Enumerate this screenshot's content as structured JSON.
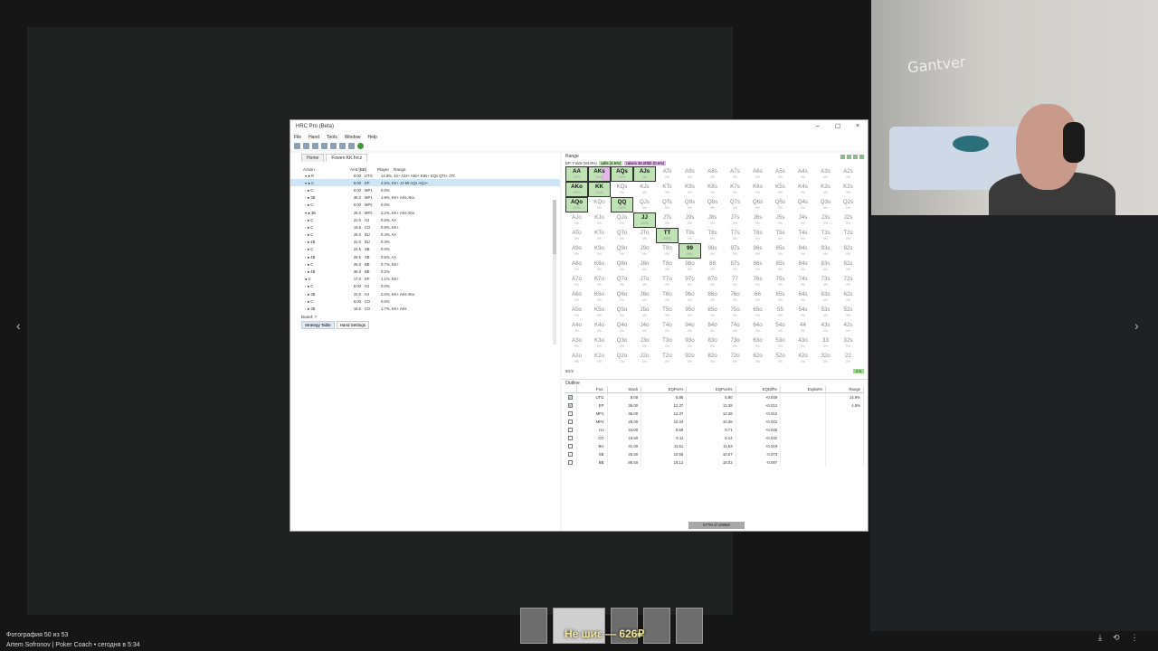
{
  "app": {
    "title": "HRC Pro (Beta)",
    "window_controls": [
      "–",
      "☐",
      "×"
    ],
    "menu": [
      "File",
      "Hand",
      "Tools",
      "Window",
      "Help"
    ],
    "tabs": [
      "Home",
      "Fowen KK.hrcz"
    ],
    "tree_headers": [
      "Action",
      "Amt [BB]",
      "Player",
      "Range"
    ],
    "tree_rows": [
      {
        "action": "▾ ● R",
        "amt": "8.00",
        "player": "UTG",
        "range": "14.9%, 44+ A2s+ A9o+ K9s+ KQo QTs+ JTs",
        "sel": false
      },
      {
        "action": "▾ ● C",
        "amt": "8.00",
        "player": "EP",
        "range": "4.5%, KK+ JJ-99 AQs AQo+",
        "sel": true
      },
      {
        "action": "› ● C",
        "amt": "8.00",
        "player": "MP1",
        "range": "0.0%",
        "sel": false
      },
      {
        "action": "› ● 3B",
        "amt": "36.0",
        "player": "MP1",
        "range": "1.9%, KK+ AKs AKo",
        "sel": false
      },
      {
        "action": "› ● C",
        "amt": "8.00",
        "player": "MP2",
        "range": "0.0%",
        "sel": false
      },
      {
        "action": "▾ ● 3B",
        "amt": "25.0",
        "player": "MP2",
        "range": "2.2%, KK+ AKs AKo",
        "sel": false
      },
      {
        "action": "› ● C",
        "amt": "22.0",
        "player": "HJ",
        "range": "0.6%, AA",
        "sel": false
      },
      {
        "action": "› ● C",
        "amt": "19.5",
        "player": "CO",
        "range": "0.9%, KK+",
        "sel": false
      },
      {
        "action": "› ● C",
        "amt": "25.0",
        "player": "BU",
        "range": "0.4%, AA",
        "sel": false
      },
      {
        "action": "› ● 4B",
        "amt": "31.0",
        "player": "BU",
        "range": "0.3%",
        "sel": false
      },
      {
        "action": "› ● C",
        "amt": "24.5",
        "player": "SB",
        "range": "0.0%",
        "sel": false
      },
      {
        "action": "› ● 4B",
        "amt": "26.5",
        "player": "SB",
        "range": "0.5%, AA",
        "sel": false
      },
      {
        "action": "› ● C",
        "amt": "25.0",
        "player": "BB",
        "range": "0.7%, KK+",
        "sel": false
      },
      {
        "action": "› ● 4B",
        "amt": "36.0",
        "player": "BB",
        "range": "0.2%",
        "sel": false
      },
      {
        "action": "  ● C",
        "amt": "17.0",
        "player": "EP",
        "range": "1.1%, KK+",
        "sel": false
      },
      {
        "action": "› ● C",
        "amt": "8.00",
        "player": "HJ",
        "range": "0.0%",
        "sel": false
      },
      {
        "action": "› ● 3B",
        "amt": "22.0",
        "player": "HJ",
        "range": "2.0%, KK+ AKs AKo",
        "sel": false
      },
      {
        "action": "› ● C",
        "amt": "8.00",
        "player": "CO",
        "range": "0.0%",
        "sel": false
      },
      {
        "action": "› ● 3B",
        "amt": "19.5",
        "player": "CO",
        "range": "1.7%, KK+ AKs",
        "sel": false
      }
    ],
    "board_label": "Board: ?",
    "bottom_tabs": [
      "Strategy Table",
      "Hand Settings"
    ],
    "range_title": "Range",
    "range_stats": {
      "fold": "EP: Folds (94.9%)",
      "call": "calls (4.5%)",
      "raise": "raises 36.00bb (0.6%)"
    },
    "range_foot_left": "94.9",
    "range_foot_right": "4.5",
    "outline_title": "Outline",
    "outline_headers": [
      "Pos.",
      "Stack",
      "EQPre%",
      "EQPost%",
      "EQDiff%",
      "Exploit%",
      "Range"
    ],
    "outline_rows": [
      {
        "checked": true,
        "pos": "UTG",
        "stack": "8.00",
        "pre": "5.85",
        "post": "5.90",
        "diff": "+0.049",
        "exploit": "",
        "range": "14.9%"
      },
      {
        "checked": true,
        "pos": "EP",
        "stack": "36.00",
        "pre": "12.37",
        "post": "12.38",
        "diff": "+0.012",
        "exploit": "",
        "range": "4.5%"
      },
      {
        "checked": false,
        "pos": "MP1",
        "stack": "36.00",
        "pre": "12.37",
        "post": "12.38",
        "diff": "+0.012",
        "exploit": "",
        "range": ""
      },
      {
        "checked": false,
        "pos": "MP2",
        "stack": "25.00",
        "pre": "10.34",
        "post": "10.36",
        "diff": "+0.021",
        "exploit": "",
        "range": ""
      },
      {
        "checked": false,
        "pos": "HJ",
        "stack": "22.00",
        "pre": "9.69",
        "post": "9.71",
        "diff": "+0.025",
        "exploit": "",
        "range": ""
      },
      {
        "checked": false,
        "pos": "CO",
        "stack": "19.50",
        "pre": "9.11",
        "post": "9.14",
        "diff": "+0.031",
        "exploit": "",
        "range": ""
      },
      {
        "checked": false,
        "pos": "BU",
        "stack": "31.00",
        "pre": "11.51",
        "post": "11.53",
        "diff": "+0.019",
        "exploit": "",
        "range": ""
      },
      {
        "checked": false,
        "pos": "SB",
        "stack": "26.50",
        "pre": "10.65",
        "post": "10.57",
        "diff": "-0.073",
        "exploit": "",
        "range": ""
      },
      {
        "checked": false,
        "pos": "BB",
        "stack": "86.50",
        "pre": "18.12",
        "post": "18.02",
        "diff": "-0.097",
        "exploit": "",
        "range": ""
      }
    ],
    "status_memory": "677M of 1096M"
  },
  "grid": {
    "ranks": [
      "A",
      "K",
      "Q",
      "J",
      "T",
      "9",
      "8",
      "7",
      "6",
      "5",
      "4",
      "3",
      "2"
    ],
    "highlight": {
      "AA": "call",
      "AKs": "mix",
      "AQs": "call",
      "AJs": "call",
      "AKo": "call",
      "KK": "call",
      "QQ": "call",
      "AQo": "call",
      "JJ": "call",
      "TT": "call",
      "99": "call"
    },
    "pct": {
      "AA": "100%",
      "AKs": "100%",
      "AQs": "100%",
      "AJs": "1%",
      "AKo": "100%",
      "KK": "100%",
      "QQ": "100%",
      "AQo": "100%",
      "JJ": "100%",
      "TT": "100%",
      "99": "80%"
    }
  },
  "viewer": {
    "wall_text": "Gantver",
    "overlay_text": "Не шиε — 626₽",
    "caption_line1": "Фотография 50 из 53",
    "caption_line2": "Artem Sofronov | Poker Coach • сегодня в 5:34",
    "nav_prev": "‹",
    "nav_next": "›",
    "icons": [
      "⤓",
      "⟲",
      "⋮"
    ]
  }
}
